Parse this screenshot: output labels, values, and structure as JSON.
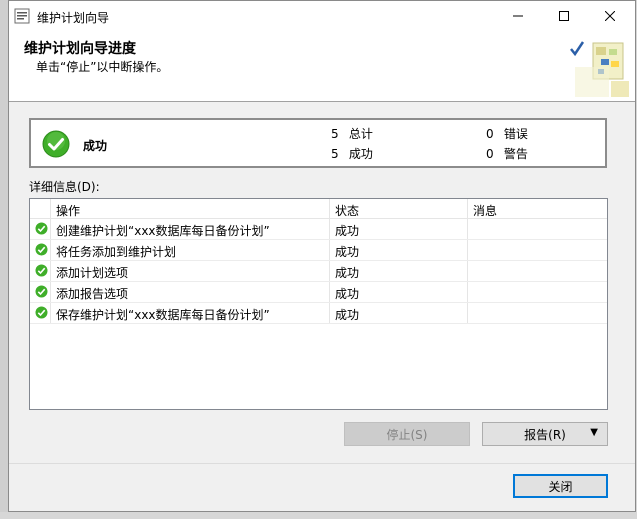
{
  "window": {
    "title": "维护计划向导",
    "controls": {
      "minimize": "minimize-icon",
      "maximize": "maximize-icon",
      "close": "close-icon"
    }
  },
  "banner": {
    "title": "维护计划向导进度",
    "subtitle": "单击“停止”以中断操作。"
  },
  "summary": {
    "status": "成功",
    "total_count": "5",
    "total_label": "总计",
    "success_count": "5",
    "success_label": "成功",
    "error_count": "0",
    "error_label": "错误",
    "warning_count": "0",
    "warning_label": "警告"
  },
  "details": {
    "label": "详细信息(D):",
    "columns": [
      "操作",
      "状态",
      "消息"
    ],
    "rows": [
      {
        "action": "创建维护计划“xxx数据库每日备份计划”",
        "status": "成功",
        "message": ""
      },
      {
        "action": "将任务添加到维护计划",
        "status": "成功",
        "message": ""
      },
      {
        "action": "添加计划选项",
        "status": "成功",
        "message": ""
      },
      {
        "action": "添加报告选项",
        "status": "成功",
        "message": ""
      },
      {
        "action": "保存维护计划“xxx数据库每日备份计划”",
        "status": "成功",
        "message": ""
      }
    ]
  },
  "buttons": {
    "stop": "停止(S)",
    "report": "报告(R)",
    "close": "关闭"
  },
  "colors": {
    "success_green": "#3fae29",
    "focus_blue": "#0078d7"
  }
}
